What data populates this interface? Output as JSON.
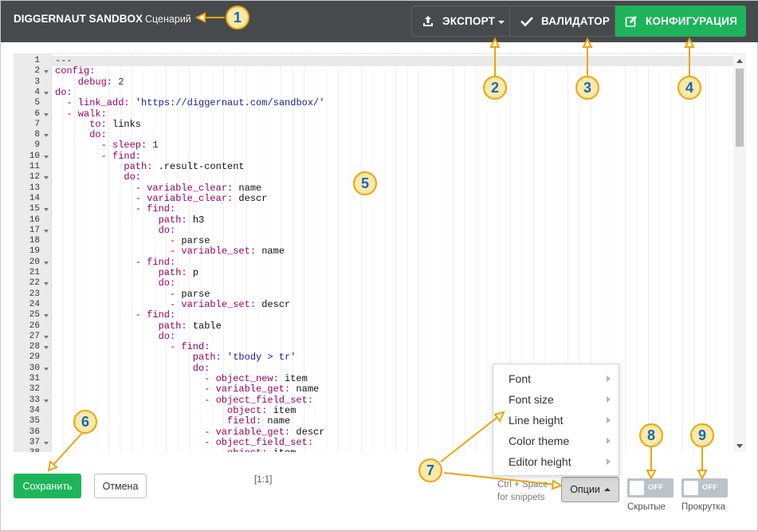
{
  "header": {
    "title": "DIGGERNAUT SANDBOX",
    "subtitle": "Сценарий",
    "buttons": {
      "export": "ЭКСПОРТ",
      "validator": "ВАЛИДАТОР",
      "config": "КОНФИГУРАЦИЯ"
    }
  },
  "colors": {
    "header_bg": "#474a4c",
    "accent_green": "#1eb45b",
    "callout_fill": "#fde9a8",
    "callout_border": "#f0a30a",
    "callout_text": "#1565c0"
  },
  "icons": {
    "export": "upload-icon",
    "validator": "check-icon",
    "config": "edit-icon"
  },
  "editor": {
    "lines": [
      {
        "n": "1",
        "fold": false,
        "indent": 0,
        "parts": [
          [
            "doc",
            "---"
          ]
        ]
      },
      {
        "n": "2",
        "fold": true,
        "indent": 0,
        "parts": [
          [
            "key",
            "config:"
          ]
        ]
      },
      {
        "n": "3",
        "fold": false,
        "indent": 2,
        "parts": [
          [
            "key",
            "debug: "
          ],
          [
            "num",
            "2"
          ]
        ]
      },
      {
        "n": "4",
        "fold": true,
        "indent": 0,
        "parts": [
          [
            "key",
            "do:"
          ]
        ]
      },
      {
        "n": "5",
        "fold": false,
        "indent": 1,
        "parts": [
          [
            "dash",
            "- "
          ],
          [
            "key",
            "link_add: "
          ],
          [
            "str",
            "'https://diggernaut.com/sandbox/'"
          ]
        ]
      },
      {
        "n": "6",
        "fold": true,
        "indent": 1,
        "parts": [
          [
            "dash",
            "- "
          ],
          [
            "key",
            "walk:"
          ]
        ]
      },
      {
        "n": "7",
        "fold": false,
        "indent": 3,
        "parts": [
          [
            "key",
            "to: "
          ],
          [
            "val",
            "links"
          ]
        ]
      },
      {
        "n": "8",
        "fold": true,
        "indent": 3,
        "parts": [
          [
            "key",
            "do:"
          ]
        ]
      },
      {
        "n": "9",
        "fold": false,
        "indent": 4,
        "parts": [
          [
            "dash",
            "- "
          ],
          [
            "key",
            "sleep: "
          ],
          [
            "num",
            "1"
          ]
        ]
      },
      {
        "n": "10",
        "fold": true,
        "indent": 4,
        "parts": [
          [
            "dash",
            "- "
          ],
          [
            "key",
            "find:"
          ]
        ]
      },
      {
        "n": "11",
        "fold": false,
        "indent": 6,
        "parts": [
          [
            "key",
            "path: "
          ],
          [
            "val",
            ".result-content"
          ]
        ]
      },
      {
        "n": "12",
        "fold": true,
        "indent": 6,
        "parts": [
          [
            "key",
            "do:"
          ]
        ]
      },
      {
        "n": "13",
        "fold": false,
        "indent": 7,
        "parts": [
          [
            "dash",
            "- "
          ],
          [
            "key",
            "variable_clear: "
          ],
          [
            "val",
            "name"
          ]
        ]
      },
      {
        "n": "14",
        "fold": false,
        "indent": 7,
        "parts": [
          [
            "dash",
            "- "
          ],
          [
            "key",
            "variable_clear: "
          ],
          [
            "val",
            "descr"
          ]
        ]
      },
      {
        "n": "15",
        "fold": true,
        "indent": 7,
        "parts": [
          [
            "dash",
            "- "
          ],
          [
            "key",
            "find:"
          ]
        ]
      },
      {
        "n": "16",
        "fold": false,
        "indent": 9,
        "parts": [
          [
            "key",
            "path: "
          ],
          [
            "val",
            "h3"
          ]
        ]
      },
      {
        "n": "17",
        "fold": true,
        "indent": 9,
        "parts": [
          [
            "key",
            "do:"
          ]
        ]
      },
      {
        "n": "18",
        "fold": false,
        "indent": 10,
        "parts": [
          [
            "dash",
            "- "
          ],
          [
            "val",
            "parse"
          ]
        ]
      },
      {
        "n": "19",
        "fold": false,
        "indent": 10,
        "parts": [
          [
            "dash",
            "- "
          ],
          [
            "key",
            "variable_set: "
          ],
          [
            "val",
            "name"
          ]
        ]
      },
      {
        "n": "20",
        "fold": true,
        "indent": 7,
        "parts": [
          [
            "dash",
            "- "
          ],
          [
            "key",
            "find:"
          ]
        ]
      },
      {
        "n": "21",
        "fold": false,
        "indent": 9,
        "parts": [
          [
            "key",
            "path: "
          ],
          [
            "val",
            "p"
          ]
        ]
      },
      {
        "n": "22",
        "fold": true,
        "indent": 9,
        "parts": [
          [
            "key",
            "do:"
          ]
        ]
      },
      {
        "n": "23",
        "fold": false,
        "indent": 10,
        "parts": [
          [
            "dash",
            "- "
          ],
          [
            "val",
            "parse"
          ]
        ]
      },
      {
        "n": "24",
        "fold": false,
        "indent": 10,
        "parts": [
          [
            "dash",
            "- "
          ],
          [
            "key",
            "variable_set: "
          ],
          [
            "val",
            "descr"
          ]
        ]
      },
      {
        "n": "25",
        "fold": true,
        "indent": 7,
        "parts": [
          [
            "dash",
            "- "
          ],
          [
            "key",
            "find:"
          ]
        ]
      },
      {
        "n": "26",
        "fold": false,
        "indent": 9,
        "parts": [
          [
            "key",
            "path: "
          ],
          [
            "val",
            "table"
          ]
        ]
      },
      {
        "n": "27",
        "fold": true,
        "indent": 9,
        "parts": [
          [
            "key",
            "do:"
          ]
        ]
      },
      {
        "n": "28",
        "fold": true,
        "indent": 10,
        "parts": [
          [
            "dash",
            "- "
          ],
          [
            "key",
            "find:"
          ]
        ]
      },
      {
        "n": "29",
        "fold": false,
        "indent": 12,
        "parts": [
          [
            "key",
            "path: "
          ],
          [
            "str",
            "'tbody > tr'"
          ]
        ]
      },
      {
        "n": "30",
        "fold": true,
        "indent": 12,
        "parts": [
          [
            "key",
            "do:"
          ]
        ]
      },
      {
        "n": "31",
        "fold": false,
        "indent": 13,
        "parts": [
          [
            "dash",
            "- "
          ],
          [
            "key",
            "object_new: "
          ],
          [
            "val",
            "item"
          ]
        ]
      },
      {
        "n": "32",
        "fold": false,
        "indent": 13,
        "parts": [
          [
            "dash",
            "- "
          ],
          [
            "key",
            "variable_get: "
          ],
          [
            "val",
            "name"
          ]
        ]
      },
      {
        "n": "33",
        "fold": true,
        "indent": 13,
        "parts": [
          [
            "dash",
            "- "
          ],
          [
            "key",
            "object_field_set:"
          ]
        ]
      },
      {
        "n": "34",
        "fold": false,
        "indent": 15,
        "parts": [
          [
            "key",
            "object: "
          ],
          [
            "val",
            "item"
          ]
        ]
      },
      {
        "n": "35",
        "fold": false,
        "indent": 15,
        "parts": [
          [
            "key",
            "field: "
          ],
          [
            "val",
            "name"
          ]
        ]
      },
      {
        "n": "36",
        "fold": false,
        "indent": 13,
        "parts": [
          [
            "dash",
            "- "
          ],
          [
            "key",
            "variable_get: "
          ],
          [
            "val",
            "descr"
          ]
        ]
      },
      {
        "n": "37",
        "fold": true,
        "indent": 13,
        "parts": [
          [
            "dash",
            "- "
          ],
          [
            "key",
            "object_field_set:"
          ]
        ]
      },
      {
        "n": "38",
        "fold": false,
        "indent": 15,
        "parts": [
          [
            "key",
            "object: "
          ],
          [
            "val",
            "item"
          ]
        ]
      }
    ]
  },
  "footer": {
    "save": "Сохранить",
    "cancel": "Отмена",
    "cursor": "[1:1]",
    "snippet_hint": "Ctrl + Space for snippets",
    "options": "Опции",
    "toggles": [
      {
        "state": "OFF",
        "label": "Скрытые",
        "on": false
      },
      {
        "state": "OFF",
        "label": "Прокрутка",
        "on": false
      }
    ]
  },
  "options_menu": {
    "items": [
      "Font",
      "Font size",
      "Line height",
      "Color theme",
      "Editor height"
    ]
  },
  "callouts": [
    "1",
    "2",
    "3",
    "4",
    "5",
    "6",
    "7",
    "8",
    "9"
  ]
}
